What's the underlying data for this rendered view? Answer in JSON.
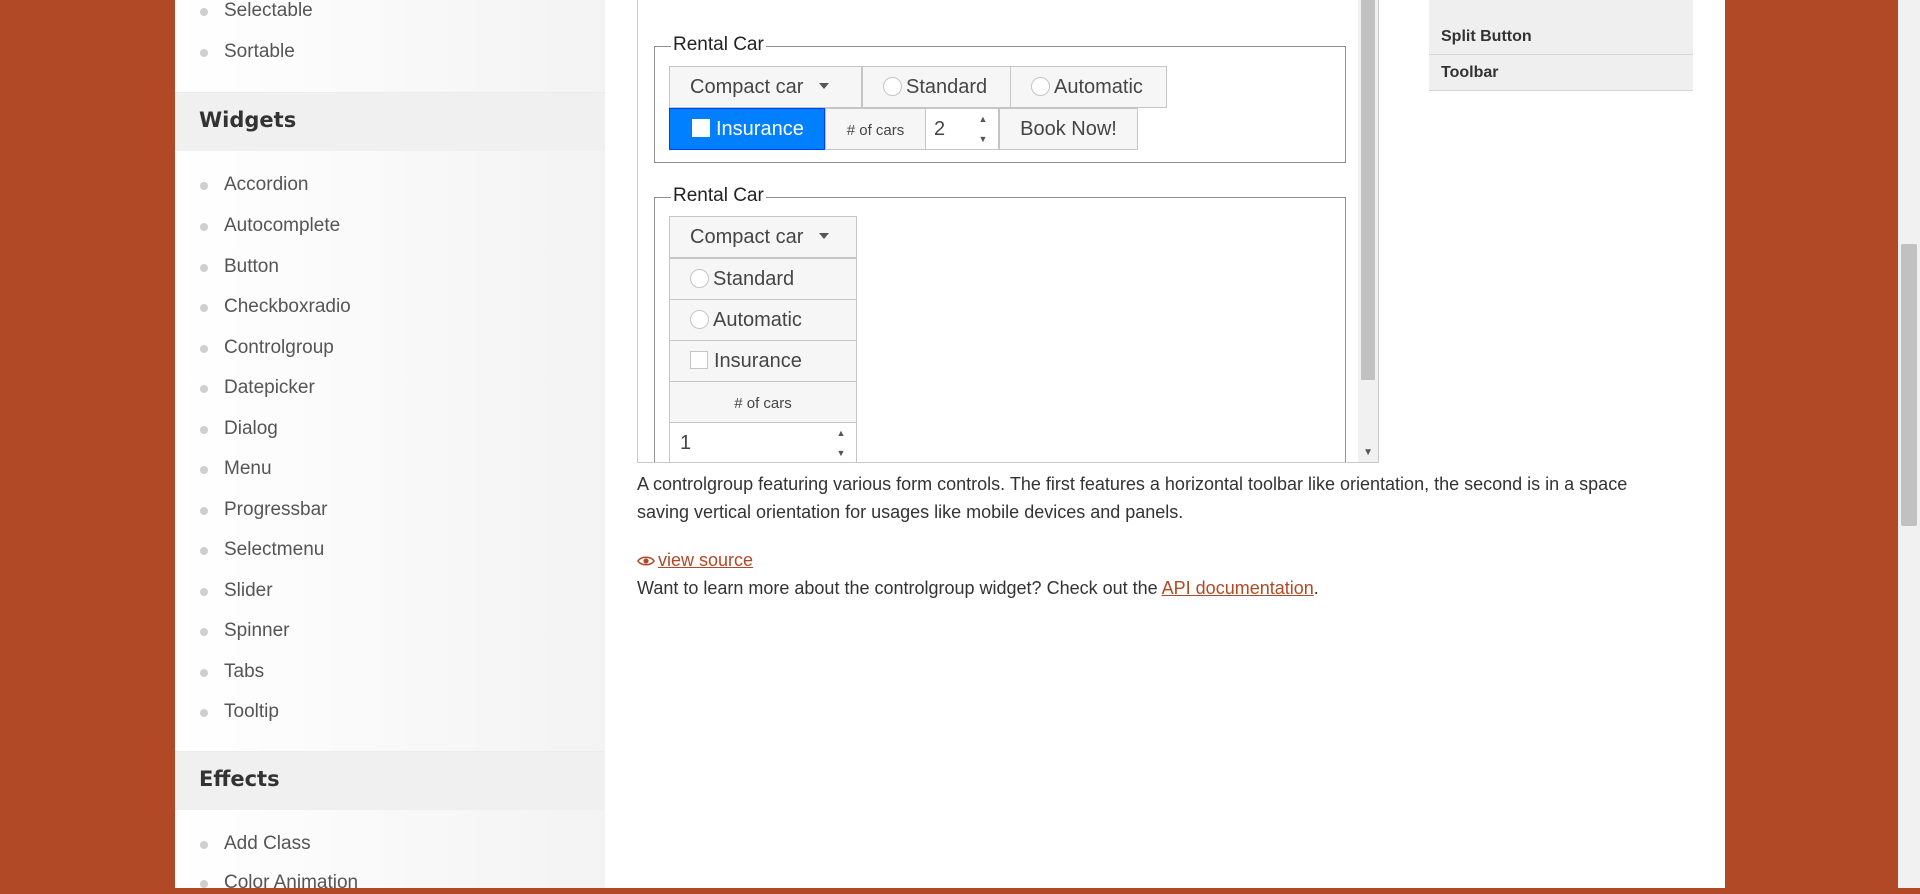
{
  "sidebar": {
    "top_items": [
      "Selectable",
      "Sortable"
    ],
    "widgets_heading": "Widgets",
    "widgets": [
      "Accordion",
      "Autocomplete",
      "Button",
      "Checkboxradio",
      "Controlgroup",
      "Datepicker",
      "Dialog",
      "Menu",
      "Progressbar",
      "Selectmenu",
      "Slider",
      "Spinner",
      "Tabs",
      "Tooltip"
    ],
    "effects_heading": "Effects",
    "effects": [
      "Add Class",
      "Color Animation"
    ]
  },
  "demo": {
    "horizontal": {
      "legend": "Rental Car",
      "select_label": "Compact car",
      "radio_standard": "Standard",
      "radio_automatic": "Automatic",
      "checkbox_insurance": "Insurance",
      "cars_label": "# of cars",
      "cars_value": "2",
      "book_button": "Book Now!"
    },
    "vertical": {
      "legend": "Rental Car",
      "select_label": "Compact car",
      "radio_standard": "Standard",
      "radio_automatic": "Automatic",
      "checkbox_insurance": "Insurance",
      "cars_label": "# of cars",
      "cars_value": "1"
    }
  },
  "description": "A controlgroup featuring various form controls. The first features a horizontal toolbar like orientation, the second is in a space saving vertical orientation for usages like mobile devices and panels.",
  "view_source": "view source",
  "learn_more_prefix": "Want to learn more about the controlgroup widget? Check out the ",
  "api_link": "API documentation",
  "learn_more_suffix": ".",
  "right_nav": [
    "Split Button",
    "Toolbar"
  ],
  "colors": {
    "brand": "#b24926",
    "active": "#007fff"
  }
}
